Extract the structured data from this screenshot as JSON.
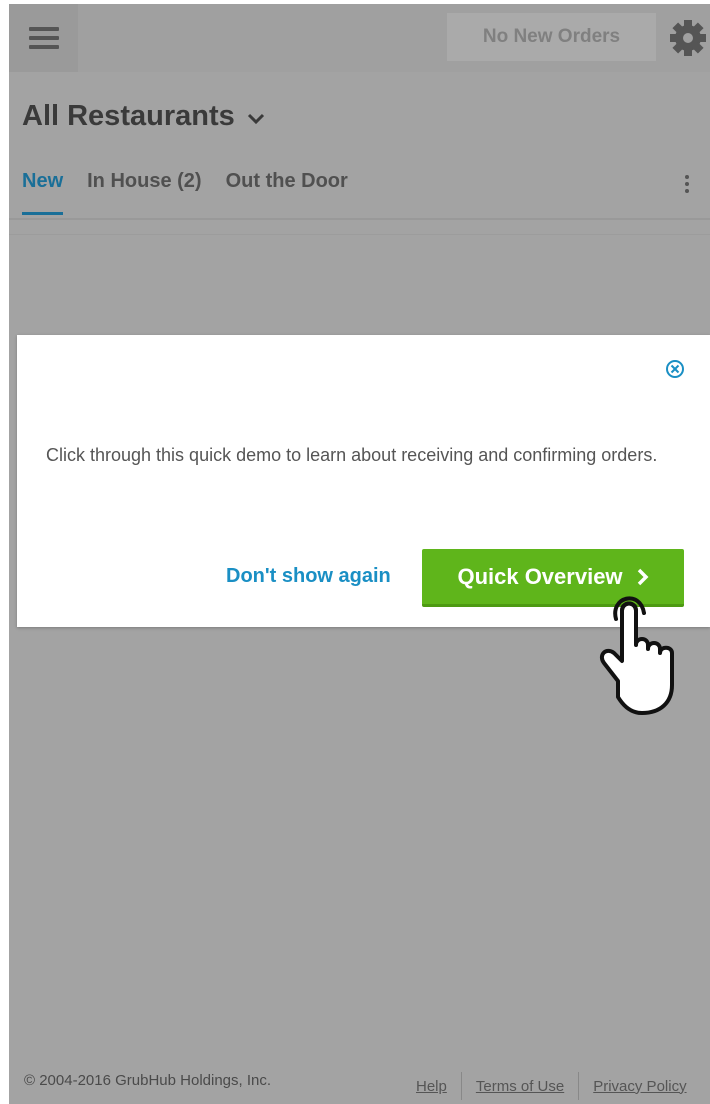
{
  "header": {
    "orders_button": "No New Orders",
    "menu_icon": "hamburger-icon",
    "settings_icon": "gear-icon"
  },
  "page": {
    "title": "All Restaurants",
    "title_icon": "chevron-down-icon"
  },
  "tabs": [
    {
      "label": "New",
      "active": true
    },
    {
      "label": "In House (2)",
      "active": false
    },
    {
      "label": "Out the Door",
      "active": false
    }
  ],
  "modal": {
    "message": "Click through this quick demo to learn about receiving and confirming orders.",
    "dont_show_label": "Don't show again",
    "quick_overview_label": "Quick Overview",
    "close_icon": "close-circle-icon"
  },
  "footer": {
    "copyright": "© 2004-2016 GrubHub Holdings, Inc.",
    "links": [
      "Help",
      "Terms of Use",
      "Privacy Policy"
    ]
  },
  "colors": {
    "accent": "#1a6f98",
    "link_blue": "#1a8fc4",
    "button_green": "#5fb51b",
    "overlay_gray": "#a3a3a3"
  }
}
